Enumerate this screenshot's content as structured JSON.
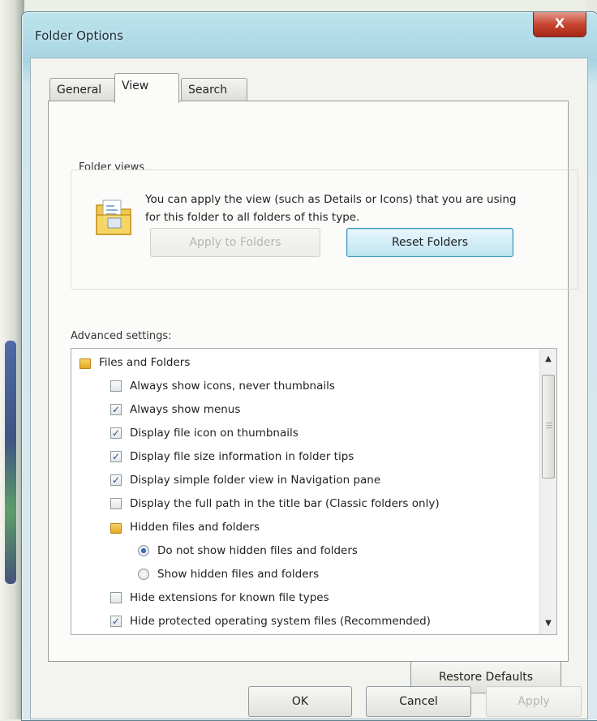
{
  "window": {
    "title": "Folder Options",
    "close_glyph": "X"
  },
  "tabs": [
    {
      "label": "General",
      "selected": false
    },
    {
      "label": "View",
      "selected": true
    },
    {
      "label": "Search",
      "selected": false
    }
  ],
  "folder_views": {
    "group_label": "Folder views",
    "icon": "folder-views-icon",
    "description": "You can apply the view (such as Details or Icons) that you are using for this folder to all folders of this type.",
    "apply_button": "Apply to Folders",
    "apply_disabled": true,
    "reset_button": "Reset Folders"
  },
  "advanced": {
    "label": "Advanced settings:",
    "items": [
      {
        "kind": "folder",
        "text": "Files and Folders",
        "level": 0
      },
      {
        "kind": "checkbox",
        "text": "Always show icons, never thumbnails",
        "checked": false,
        "level": 1
      },
      {
        "kind": "checkbox",
        "text": "Always show menus",
        "checked": true,
        "level": 1
      },
      {
        "kind": "checkbox",
        "text": "Display file icon on thumbnails",
        "checked": true,
        "level": 1
      },
      {
        "kind": "checkbox",
        "text": "Display file size information in folder tips",
        "checked": true,
        "level": 1
      },
      {
        "kind": "checkbox",
        "text": "Display simple folder view in Navigation pane",
        "checked": true,
        "level": 1
      },
      {
        "kind": "checkbox",
        "text": "Display the full path in the title bar (Classic folders only)",
        "checked": false,
        "level": 1
      },
      {
        "kind": "folder",
        "text": "Hidden files and folders",
        "level": 1
      },
      {
        "kind": "radio",
        "text": "Do not show hidden files and folders",
        "checked": true,
        "level": 2
      },
      {
        "kind": "radio",
        "text": "Show hidden files and folders",
        "checked": false,
        "level": 2
      },
      {
        "kind": "checkbox",
        "text": "Hide extensions for known file types",
        "checked": false,
        "level": 1
      },
      {
        "kind": "checkbox",
        "text": "Hide protected operating system files (Recommended)",
        "checked": true,
        "level": 1
      }
    ],
    "restore_button": "Restore Defaults"
  },
  "footer": {
    "ok": "OK",
    "cancel": "Cancel",
    "apply": "Apply",
    "apply_disabled": true
  },
  "colors": {
    "title_glass": "#a7d4e2",
    "close_red": "#c84631",
    "focus_blue": "#3c94b8"
  }
}
